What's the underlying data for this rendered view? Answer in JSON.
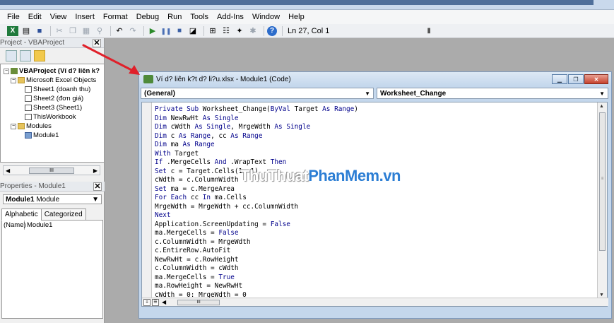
{
  "menu": [
    "File",
    "Edit",
    "View",
    "Insert",
    "Format",
    "Debug",
    "Run",
    "Tools",
    "Add-Ins",
    "Window",
    "Help"
  ],
  "menu_underline": [
    "F",
    "E",
    "V",
    "I",
    "o",
    "D",
    "R",
    "T",
    "A",
    "W",
    "H"
  ],
  "toolbar": {
    "status": "Ln 27, Col 1"
  },
  "project_panel": {
    "title": "Project - VBAProject",
    "root": "VBAProject (Ví d? liên k?",
    "objects_folder": "Microsoft Excel Objects",
    "sheets": [
      "Sheet1 (doanh thu)",
      "Sheet2 (đơn giá)",
      "Sheet3 (Sheet1)"
    ],
    "workbook": "ThisWorkbook",
    "modules_folder": "Modules",
    "module": "Module1"
  },
  "properties_panel": {
    "title": "Properties - Module1",
    "selected_object": "Module1",
    "selected_type": "Module",
    "tabs": [
      "Alphabetic",
      "Categorized"
    ],
    "prop_name": "(Name)",
    "prop_value": "Module1"
  },
  "code_window": {
    "title": "Ví d? liên k?t d? li?u.xlsx - Module1 (Code)",
    "object_combo": "(General)",
    "proc_combo": "Worksheet_Change",
    "lines": [
      "Private Sub Worksheet_Change(ByVal Target As Range)",
      "Dim NewRwHt As Single",
      "Dim cWdth As Single, MrgeWdth As Single",
      "Dim c As Range, cc As Range",
      "Dim ma As Range",
      "With Target",
      "If .MergeCells And .WrapText Then",
      "Set c = Target.Cells(1, 1)",
      "cWdth = c.ColumnWidth",
      "Set ma = c.MergeArea",
      "For Each cc In ma.Cells",
      "MrgeWdth = MrgeWdth + cc.ColumnWidth",
      "Next",
      "Application.ScreenUpdating = False",
      "ma.MergeCells = False",
      "c.ColumnWidth = MrgeWdth",
      "c.EntireRow.AutoFit",
      "NewRwHt = c.RowHeight",
      "c.ColumnWidth = cWdth",
      "ma.MergeCells = True",
      "ma.RowHeight = NewRwHt",
      "cWdth = 0: MrgeWdth = 0"
    ]
  },
  "watermark": {
    "part1": "ThuThuat",
    "part2": "PhanMem.vn"
  },
  "colors": {
    "arrow": "#e0202a",
    "keyword": "#00008b",
    "accent": "#2c7ed4"
  }
}
